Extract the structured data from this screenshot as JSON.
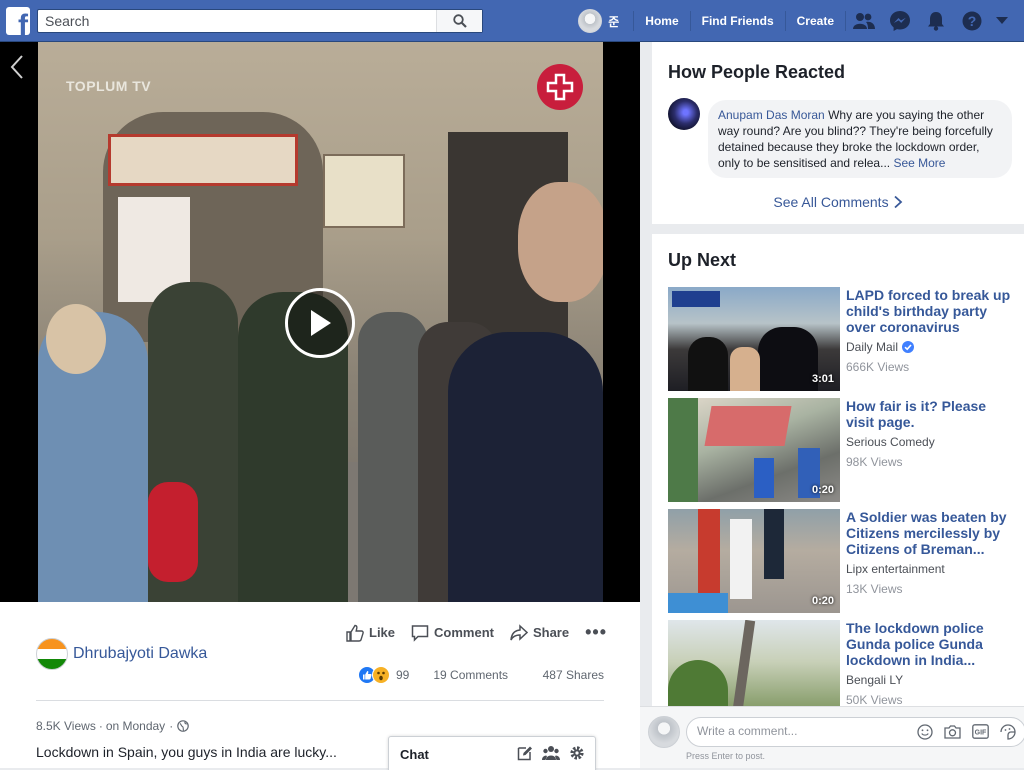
{
  "header": {
    "search_placeholder": "Search",
    "user_name": "준",
    "nav": [
      "Home",
      "Find Friends",
      "Create"
    ]
  },
  "video": {
    "watermark": "TOPLUM TV"
  },
  "post": {
    "actions": {
      "like": "Like",
      "comment": "Comment",
      "share": "Share"
    },
    "author": "Dhrubajyoti Dawka",
    "reaction_count": "99",
    "comments_count": "19 Comments",
    "shares_count": "487 Shares",
    "views": "8.5K Views",
    "time": "on Monday",
    "caption": "Lockdown in Spain, you guys in India are lucky..."
  },
  "chat": {
    "title": "Chat"
  },
  "reactions_panel": {
    "title": "How People Reacted",
    "comment": {
      "author": "Anupam Das Moran",
      "text": "Why are you saying the other way round? Are you blind?? They're being forcefully detained because they broke the lockdown order, only to be sensitised and relea...",
      "see_more": "See More"
    },
    "see_all": "See All Comments"
  },
  "up_next": {
    "title": "Up Next",
    "videos": [
      {
        "title": "LAPD forced to break up child's birthday party over coronavirus",
        "source": "Daily Mail",
        "verified": true,
        "views": "666K Views",
        "duration": "3:01"
      },
      {
        "title": "How fair is it? Please visit page.",
        "source": "Serious Comedy",
        "verified": false,
        "views": "98K Views",
        "duration": "0:20"
      },
      {
        "title": "A Soldier was beaten by Citizens mercilessly by Citizens of Breman...",
        "source": "Lipx entertainment",
        "verified": false,
        "views": "13K Views",
        "duration": "0:20"
      },
      {
        "title": "The lockdown police Gunda police Gunda lockdown in India...",
        "source": "Bengali LY",
        "verified": false,
        "views": "50K Views",
        "duration": ""
      }
    ]
  },
  "comment_box": {
    "placeholder": "Write a comment...",
    "hint": "Press Enter to post."
  },
  "colors": {
    "brand": "#4267b2",
    "link": "#365899"
  }
}
